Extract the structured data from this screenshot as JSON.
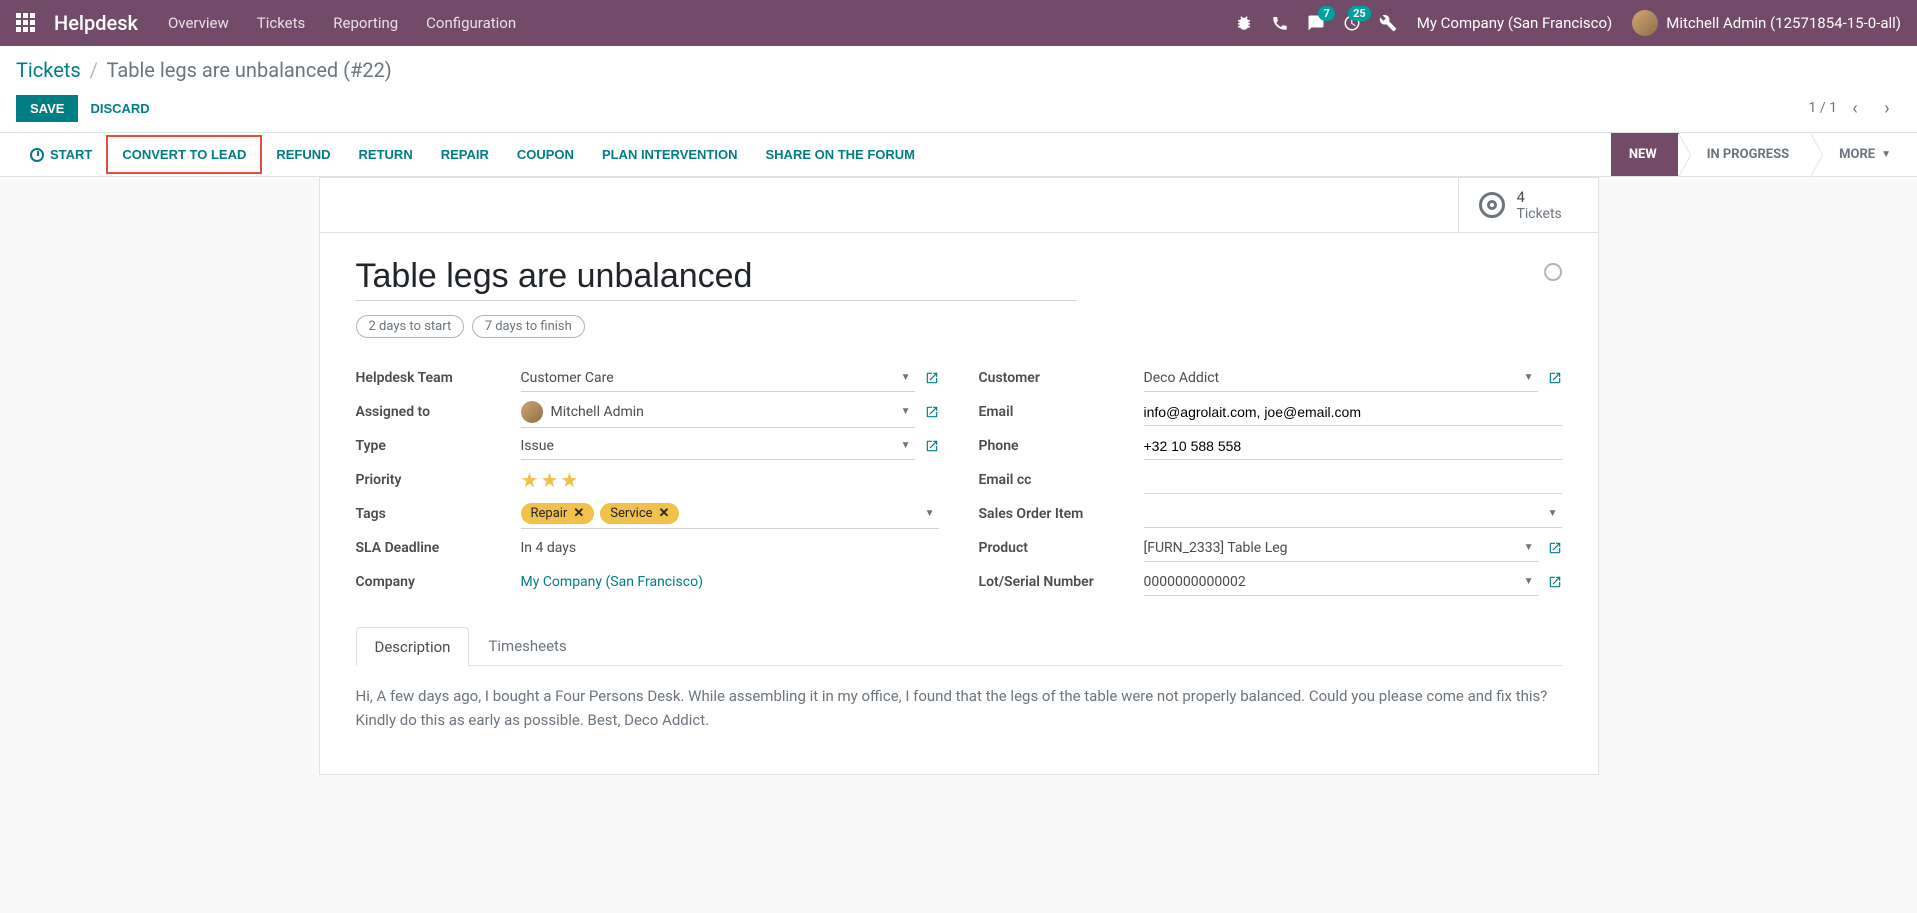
{
  "topnav": {
    "brand": "Helpdesk",
    "items": [
      "Overview",
      "Tickets",
      "Reporting",
      "Configuration"
    ],
    "messaging_badge": "7",
    "activities_badge": "25",
    "company": "My Company (San Francisco)",
    "user": "Mitchell Admin (12571854-15-0-all)"
  },
  "breadcrumb": {
    "parent": "Tickets",
    "current": "Table legs are unbalanced (#22)"
  },
  "buttons": {
    "save": "SAVE",
    "discard": "DISCARD"
  },
  "pager": {
    "text": "1 / 1"
  },
  "actions": {
    "start": "START",
    "convert": "CONVERT TO LEAD",
    "refund": "REFUND",
    "return": "RETURN",
    "repair": "REPAIR",
    "coupon": "COUPON",
    "plan": "PLAN INTERVENTION",
    "share": "SHARE ON THE FORUM"
  },
  "stages": {
    "new": "NEW",
    "in_progress": "IN PROGRESS",
    "more": "MORE"
  },
  "stat": {
    "count": "4",
    "label": "Tickets"
  },
  "title": "Table legs are unbalanced",
  "sla": {
    "start": "2 days to start",
    "finish": "7 days to finish"
  },
  "labels": {
    "team": "Helpdesk Team",
    "assigned": "Assigned to",
    "type": "Type",
    "priority": "Priority",
    "tags": "Tags",
    "deadline": "SLA Deadline",
    "company": "Company",
    "customer": "Customer",
    "email": "Email",
    "phone": "Phone",
    "emailcc": "Email cc",
    "salesitem": "Sales Order Item",
    "product": "Product",
    "lot": "Lot/Serial Number"
  },
  "values": {
    "team": "Customer Care",
    "assigned": "Mitchell Admin",
    "type": "Issue",
    "tags": [
      "Repair",
      "Service"
    ],
    "deadline": "In 4 days",
    "company": "My Company (San Francisco)",
    "customer": "Deco Addict",
    "email": "info@agrolait.com, joe@email.com",
    "phone": "+32 10 588 558",
    "emailcc": "",
    "salesitem": "",
    "product": "[FURN_2333] Table Leg",
    "lot": "0000000000002"
  },
  "tabs": {
    "desc": "Description",
    "timesheets": "Timesheets"
  },
  "description": "Hi, A few days ago, I bought a Four Persons Desk. While assembling it in my office, I found that the legs of the table were not properly balanced. Could you please come and fix this? Kindly do this as early as possible. Best, Deco Addict."
}
